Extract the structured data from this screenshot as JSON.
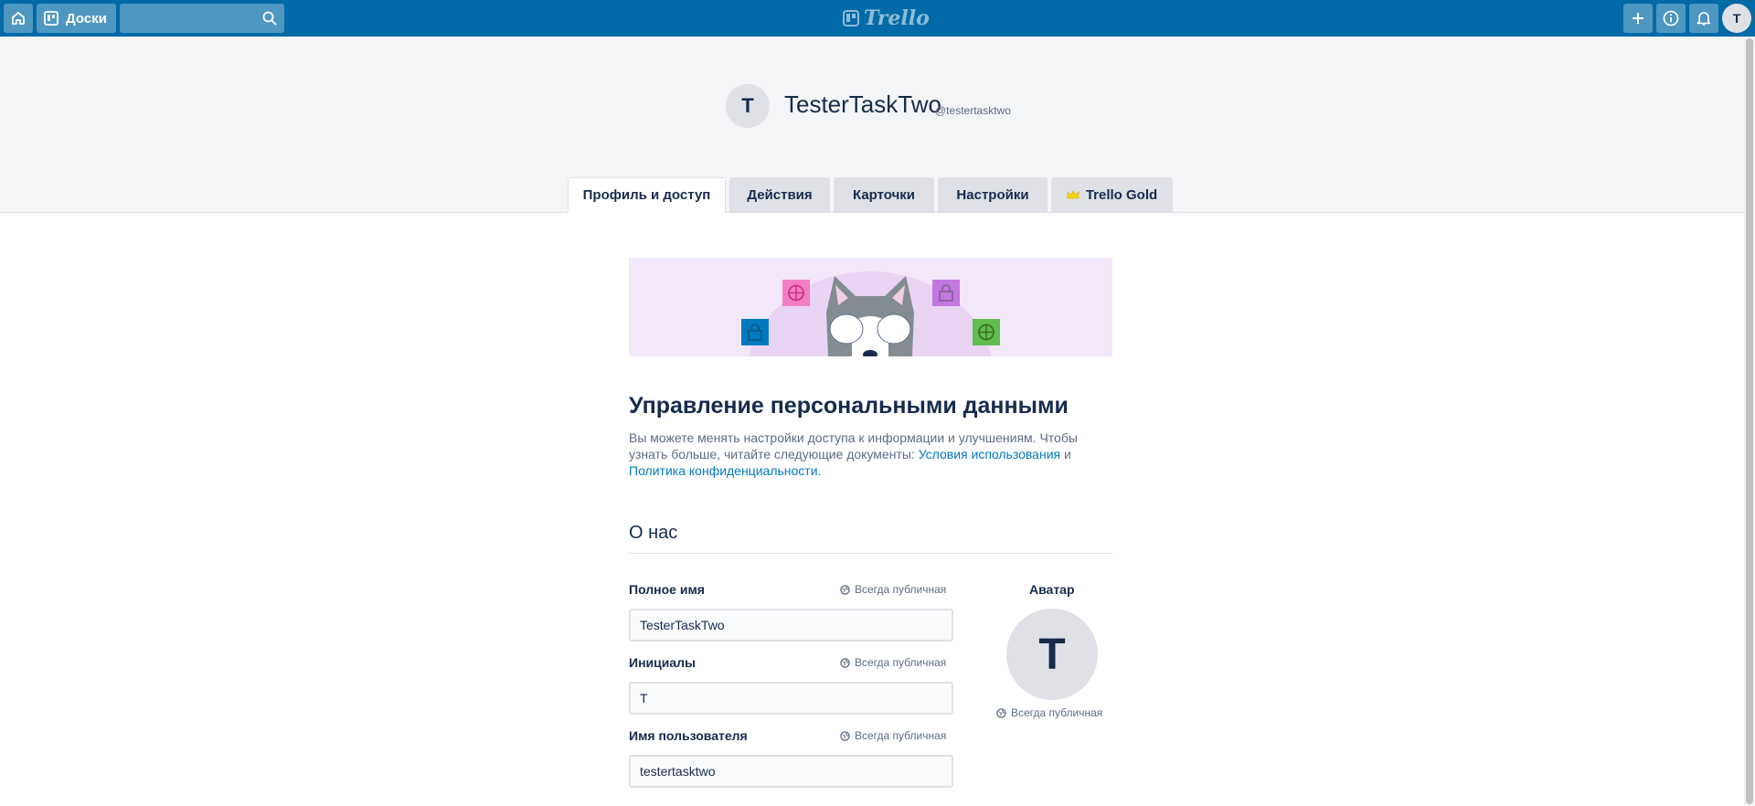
{
  "header": {
    "boards_label": "Доски",
    "search_value": "",
    "logo_text": "Trello",
    "user_initial": "T"
  },
  "profile": {
    "initial": "T",
    "name": "TesterTaskTwo",
    "handle": "@testertasktwo"
  },
  "tabs": [
    {
      "label": "Профиль и доступ",
      "active": true
    },
    {
      "label": "Действия",
      "active": false
    },
    {
      "label": "Карточки",
      "active": false
    },
    {
      "label": "Настройки",
      "active": false
    },
    {
      "label": "Trello Gold",
      "active": false,
      "icon": "crown-icon"
    }
  ],
  "privacy": {
    "title": "Управление персональными данными",
    "desc_text": "Вы можете менять настройки доступа к информации и улучшениям. Чтобы узнать больше, читайте следующие документы: ",
    "terms_link": "Условия использования",
    "and_text": " и ",
    "privacy_link": "Политика конфиденциальности."
  },
  "about": {
    "title": "О нас",
    "public_label": "Всегда публичная",
    "fields": [
      {
        "label": "Полное имя",
        "value": "TesterTaskTwo"
      },
      {
        "label": "Инициалы",
        "value": "T"
      },
      {
        "label": "Имя пользователя",
        "value": "testertasktwo"
      }
    ],
    "avatar_label": "Аватар",
    "avatar_initial": "T"
  },
  "colors": {
    "header_bg": "#026aa7",
    "link": "#0079bf",
    "text": "#172b4d",
    "muted": "#5e6c84",
    "banner_bg": "#f3e8f9",
    "gold": "#f2d600"
  }
}
